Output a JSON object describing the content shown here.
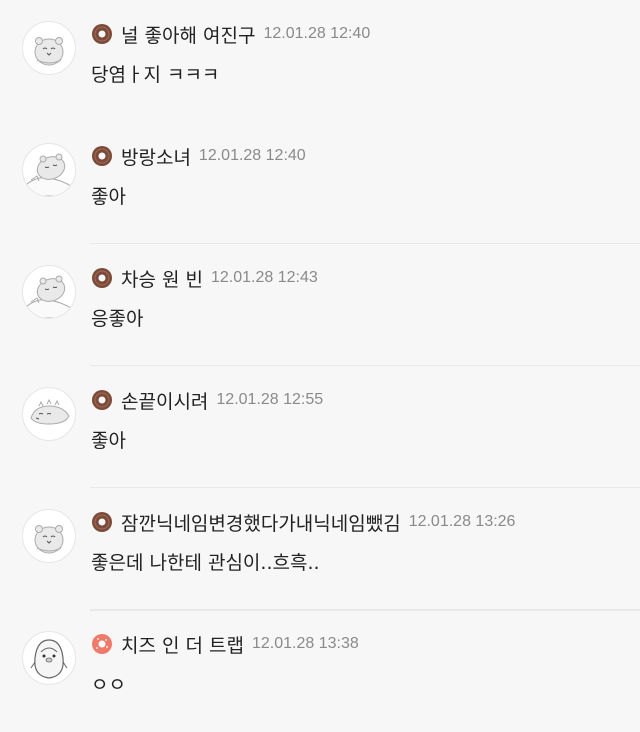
{
  "comments": [
    {
      "nickname": "널 좋아해 여진구",
      "time": "12.01.28 12:40",
      "text": "당염ㅏ지 ㅋㅋㅋ",
      "avatar_icon": "hamster-icon",
      "level_icon": "donut-dark-icon",
      "level_color": "#7a4a3a"
    },
    {
      "nickname": "방랑소녀",
      "time": "12.01.28 12:40",
      "text": "좋아",
      "avatar_icon": "sleeping-hamster-icon",
      "level_icon": "donut-dark-icon",
      "level_color": "#7a4a3a"
    },
    {
      "nickname": "차승 원 빈",
      "time": "12.01.28 12:43",
      "text": "응좋아",
      "avatar_icon": "sleeping-hamster-icon",
      "level_icon": "donut-dark-icon",
      "level_color": "#7a4a3a"
    },
    {
      "nickname": "손끝이시려",
      "time": "12.01.28 12:55",
      "text": "좋아",
      "avatar_icon": "lying-hamster-icon",
      "level_icon": "donut-dark-icon",
      "level_color": "#7a4a3a"
    },
    {
      "nickname": "잠깐닉네임변경했다가내닉네임뺐김",
      "time": "12.01.28 13:26",
      "text": "좋은데 나한테 관심이..흐흑..",
      "avatar_icon": "hamster-icon",
      "level_icon": "donut-dark-icon",
      "level_color": "#7a4a3a"
    },
    {
      "nickname": "치즈 인 더 트랩",
      "time": "12.01.28 13:38",
      "text": "ㅇㅇ",
      "avatar_icon": "penguin-icon",
      "level_icon": "donut-pink-icon",
      "level_color": "#f07a6a"
    }
  ]
}
